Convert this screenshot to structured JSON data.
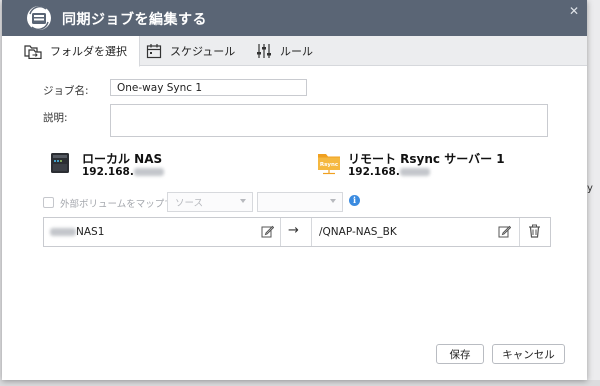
{
  "dialog": {
    "title": "同期ジョブを編集する",
    "close_symbol": "✕"
  },
  "tabs": [
    {
      "label": "フォルダを選択",
      "icon": "folder-copy-icon",
      "active": true
    },
    {
      "label": "スケジュール",
      "icon": "calendar-icon",
      "active": false
    },
    {
      "label": "ルール",
      "icon": "sliders-icon",
      "active": false
    }
  ],
  "form": {
    "job_name_label": "ジョブ名:",
    "job_name_value": "One-way Sync 1",
    "description_label": "説明:",
    "description_value": ""
  },
  "local": {
    "name": "ローカル NAS",
    "ip_prefix": "192.168.",
    "icon": "nas-device-icon"
  },
  "remote": {
    "name": "リモート Rsync サーバー 1",
    "ip_prefix": "192.168.",
    "icon": "rsync-server-icon",
    "icon_text": "Rsync",
    "accent": "#f0a020"
  },
  "external": {
    "checkbox_label": "外部ボリュームをマップする",
    "source_placeholder": "ソース",
    "target_placeholder": "",
    "info_symbol": "i"
  },
  "folder_pair": {
    "source_folder": "NAS1",
    "arrow": "→",
    "destination_folder": "/QNAP-NAS_BK"
  },
  "buttons": {
    "save": "保存",
    "cancel": "キャンセル"
  },
  "background": {
    "edge_text": "y"
  }
}
